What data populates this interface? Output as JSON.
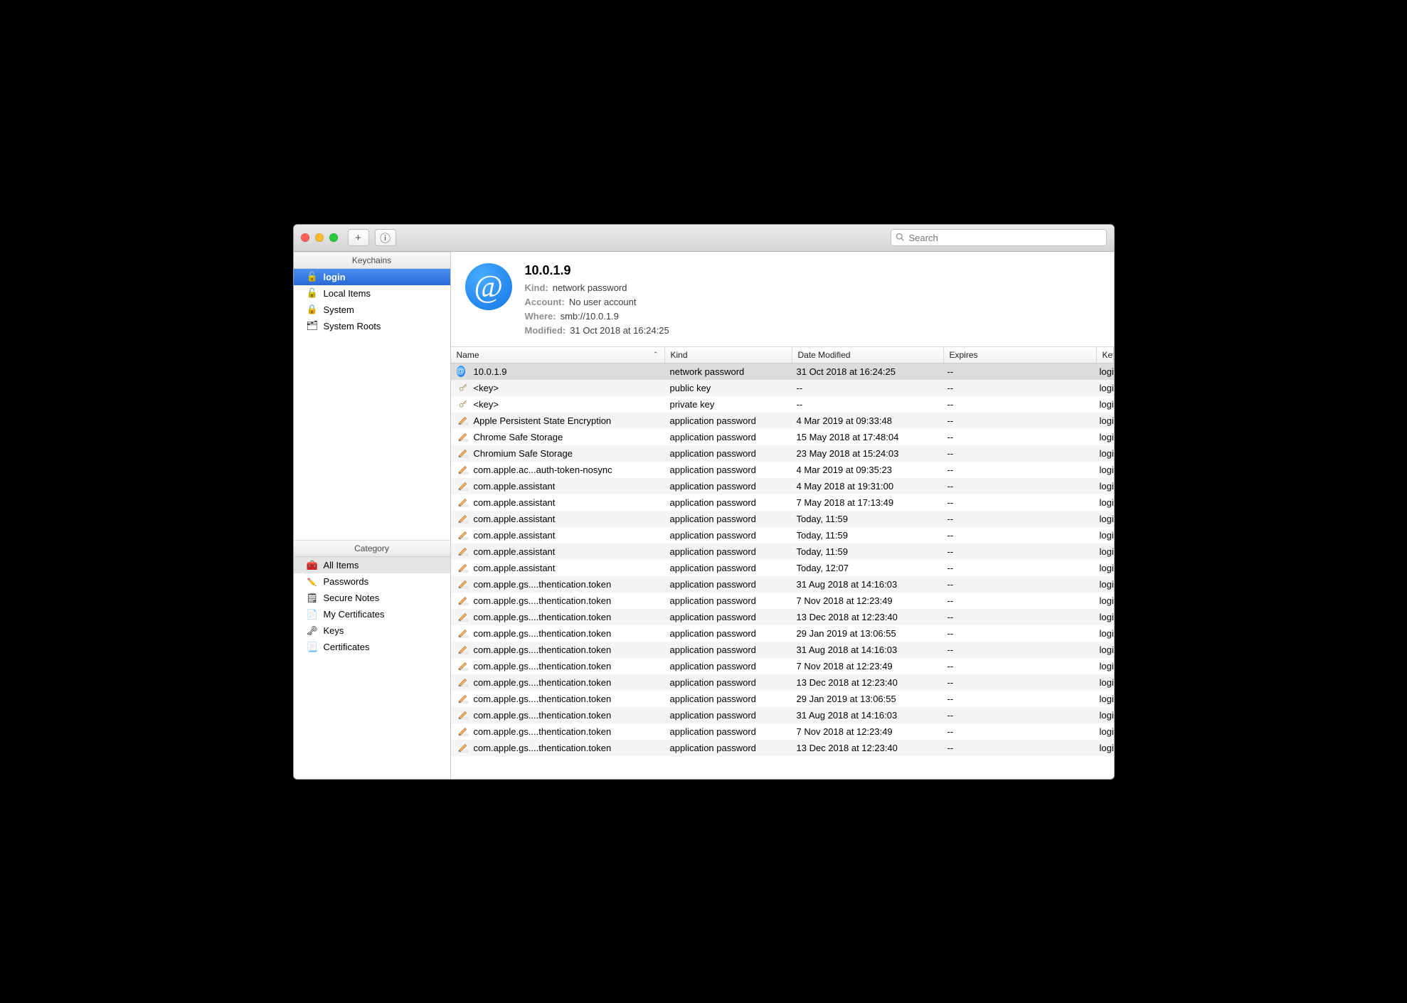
{
  "toolbar": {
    "add_label": "+",
    "info_label": "ⓘ",
    "search_placeholder": "Search"
  },
  "sidebar": {
    "keychains_header": "Keychains",
    "category_header": "Category",
    "keychains": [
      {
        "label": "login",
        "icon": "lock-open",
        "selected": true
      },
      {
        "label": "Local Items",
        "icon": "lock-open"
      },
      {
        "label": "System",
        "icon": "lock"
      },
      {
        "label": "System Roots",
        "icon": "folder-lock"
      }
    ],
    "categories": [
      {
        "label": "All Items",
        "icon": "all",
        "selected": true
      },
      {
        "label": "Passwords",
        "icon": "pass"
      },
      {
        "label": "Secure Notes",
        "icon": "note"
      },
      {
        "label": "My Certificates",
        "icon": "cert"
      },
      {
        "label": "Keys",
        "icon": "key"
      },
      {
        "label": "Certificates",
        "icon": "cert2"
      }
    ]
  },
  "detail": {
    "title": "10.0.1.9",
    "kind_label": "Kind:",
    "kind_value": "network password",
    "account_label": "Account:",
    "account_value": "No user account",
    "where_label": "Where:",
    "where_value": "smb://10.0.1.9",
    "modified_label": "Modified:",
    "modified_value": "31 Oct 2018 at 16:24:25"
  },
  "table": {
    "columns": {
      "name": "Name",
      "kind": "Kind",
      "date_modified": "Date Modified",
      "expires": "Expires",
      "keychain": "Keychain"
    },
    "sort_indicator": "⌃",
    "rows": [
      {
        "icon": "at",
        "name": "10.0.1.9",
        "kind": "network password",
        "date": "31 Oct 2018 at 16:24:25",
        "expires": "--",
        "keychain": "login",
        "selected": true
      },
      {
        "icon": "key",
        "name": "<key>",
        "kind": "public key",
        "date": "--",
        "expires": "--",
        "keychain": "login"
      },
      {
        "icon": "key",
        "name": "<key>",
        "kind": "private key",
        "date": "--",
        "expires": "--",
        "keychain": "login"
      },
      {
        "icon": "pencil",
        "name": "Apple Persistent State Encryption",
        "kind": "application password",
        "date": "4 Mar 2019 at 09:33:48",
        "expires": "--",
        "keychain": "login"
      },
      {
        "icon": "pencil",
        "name": "Chrome Safe Storage",
        "kind": "application password",
        "date": "15 May 2018 at 17:48:04",
        "expires": "--",
        "keychain": "login"
      },
      {
        "icon": "pencil",
        "name": "Chromium Safe Storage",
        "kind": "application password",
        "date": "23 May 2018 at 15:24:03",
        "expires": "--",
        "keychain": "login"
      },
      {
        "icon": "pencil",
        "name": "com.apple.ac...auth-token-nosync",
        "kind": "application password",
        "date": "4 Mar 2019 at 09:35:23",
        "expires": "--",
        "keychain": "login"
      },
      {
        "icon": "pencil",
        "name": "com.apple.assistant",
        "kind": "application password",
        "date": "4 May 2018 at 19:31:00",
        "expires": "--",
        "keychain": "login"
      },
      {
        "icon": "pencil",
        "name": "com.apple.assistant",
        "kind": "application password",
        "date": "7 May 2018 at 17:13:49",
        "expires": "--",
        "keychain": "login"
      },
      {
        "icon": "pencil",
        "name": "com.apple.assistant",
        "kind": "application password",
        "date": "Today, 11:59",
        "expires": "--",
        "keychain": "login"
      },
      {
        "icon": "pencil",
        "name": "com.apple.assistant",
        "kind": "application password",
        "date": "Today, 11:59",
        "expires": "--",
        "keychain": "login"
      },
      {
        "icon": "pencil",
        "name": "com.apple.assistant",
        "kind": "application password",
        "date": "Today, 11:59",
        "expires": "--",
        "keychain": "login"
      },
      {
        "icon": "pencil",
        "name": "com.apple.assistant",
        "kind": "application password",
        "date": "Today, 12:07",
        "expires": "--",
        "keychain": "login"
      },
      {
        "icon": "pencil",
        "name": "com.apple.gs....thentication.token",
        "kind": "application password",
        "date": "31 Aug 2018 at 14:16:03",
        "expires": "--",
        "keychain": "login"
      },
      {
        "icon": "pencil",
        "name": "com.apple.gs....thentication.token",
        "kind": "application password",
        "date": "7 Nov 2018 at 12:23:49",
        "expires": "--",
        "keychain": "login"
      },
      {
        "icon": "pencil",
        "name": "com.apple.gs....thentication.token",
        "kind": "application password",
        "date": "13 Dec 2018 at 12:23:40",
        "expires": "--",
        "keychain": "login"
      },
      {
        "icon": "pencil",
        "name": "com.apple.gs....thentication.token",
        "kind": "application password",
        "date": "29 Jan 2019 at 13:06:55",
        "expires": "--",
        "keychain": "login"
      },
      {
        "icon": "pencil",
        "name": "com.apple.gs....thentication.token",
        "kind": "application password",
        "date": "31 Aug 2018 at 14:16:03",
        "expires": "--",
        "keychain": "login"
      },
      {
        "icon": "pencil",
        "name": "com.apple.gs....thentication.token",
        "kind": "application password",
        "date": "7 Nov 2018 at 12:23:49",
        "expires": "--",
        "keychain": "login"
      },
      {
        "icon": "pencil",
        "name": "com.apple.gs....thentication.token",
        "kind": "application password",
        "date": "13 Dec 2018 at 12:23:40",
        "expires": "--",
        "keychain": "login"
      },
      {
        "icon": "pencil",
        "name": "com.apple.gs....thentication.token",
        "kind": "application password",
        "date": "29 Jan 2019 at 13:06:55",
        "expires": "--",
        "keychain": "login"
      },
      {
        "icon": "pencil",
        "name": "com.apple.gs....thentication.token",
        "kind": "application password",
        "date": "31 Aug 2018 at 14:16:03",
        "expires": "--",
        "keychain": "login"
      },
      {
        "icon": "pencil",
        "name": "com.apple.gs....thentication.token",
        "kind": "application password",
        "date": "7 Nov 2018 at 12:23:49",
        "expires": "--",
        "keychain": "login"
      },
      {
        "icon": "pencil",
        "name": "com.apple.gs....thentication.token",
        "kind": "application password",
        "date": "13 Dec 2018 at 12:23:40",
        "expires": "--",
        "keychain": "login"
      }
    ]
  }
}
